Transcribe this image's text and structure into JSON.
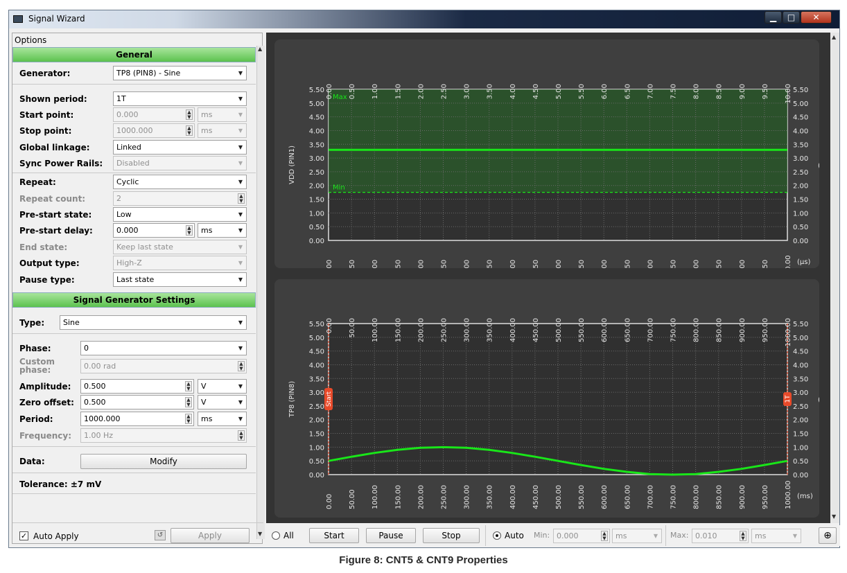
{
  "window": {
    "title": "Signal Wizard"
  },
  "options_label": "Options",
  "general": {
    "header": "General",
    "generator_label": "Generator:",
    "generator_value": "TP8 (PIN8) - Sine",
    "shown_period_label": "Shown period:",
    "shown_period_value": "1T",
    "start_point_label": "Start point:",
    "start_point_value": "0.000",
    "start_point_unit": "ms",
    "stop_point_label": "Stop point:",
    "stop_point_value": "1000.000",
    "stop_point_unit": "ms",
    "global_linkage_label": "Global linkage:",
    "global_linkage_value": "Linked",
    "sync_power_rails_label": "Sync Power Rails:",
    "sync_power_rails_value": "Disabled",
    "repeat_label": "Repeat:",
    "repeat_value": "Cyclic",
    "repeat_count_label": "Repeat count:",
    "repeat_count_value": "2",
    "pre_start_state_label": "Pre-start state:",
    "pre_start_state_value": "Low",
    "pre_start_delay_label": "Pre-start delay:",
    "pre_start_delay_value": "0.000",
    "pre_start_delay_unit": "ms",
    "end_state_label": "End state:",
    "end_state_value": "Keep last state",
    "output_type_label": "Output type:",
    "output_type_value": "High-Z",
    "pause_type_label": "Pause type:",
    "pause_type_value": "Last state"
  },
  "siggen": {
    "header": "Signal Generator Settings",
    "type_label": "Type:",
    "type_value": "Sine",
    "phase_label": "Phase:",
    "phase_value": "0",
    "custom_phase_label": "Custom phase:",
    "custom_phase_value": "0.00 rad",
    "amplitude_label": "Amplitude:",
    "amplitude_value": "0.500",
    "amplitude_unit": "V",
    "zero_offset_label": "Zero offset:",
    "zero_offset_value": "0.500",
    "zero_offset_unit": "V",
    "period_label": "Period:",
    "period_value": "1000.000",
    "period_unit": "ms",
    "frequency_label": "Frequency:",
    "frequency_value": "1.00 Hz",
    "data_label": "Data:",
    "modify_label": "Modify",
    "tolerance": "Tolerance: ±7 mV"
  },
  "footer_left": {
    "auto_apply": "Auto Apply",
    "apply": "Apply"
  },
  "bottombar": {
    "all": "All",
    "start": "Start",
    "pause": "Pause",
    "stop": "Stop",
    "auto": "Auto",
    "min_label": "Min:",
    "min_value": "0.000",
    "min_unit": "ms",
    "max_label": "Max:",
    "max_value": "0.010",
    "max_unit": "ms"
  },
  "caption": "Figure 8: CNT5 & CNT9 Properties",
  "colors": {
    "signal": "#19e619",
    "band": "#2a5a2a",
    "marker": "#e84a2a",
    "grid": "#6a6a6a"
  },
  "chart_data": [
    {
      "type": "line",
      "ylabel": "VDD (PIN1)",
      "yunit": "(V)",
      "xunit": "(µs)",
      "x_ticks": [
        "0.00",
        "0.50",
        "1.00",
        "1.50",
        "2.00",
        "2.50",
        "3.00",
        "3.50",
        "4.00",
        "4.50",
        "5.00",
        "5.50",
        "6.00",
        "6.50",
        "7.00",
        "7.50",
        "8.00",
        "8.50",
        "9.00",
        "9.50",
        "10.00"
      ],
      "y_ticks": [
        "0.00",
        "0.50",
        "1.00",
        "1.50",
        "2.00",
        "2.50",
        "3.00",
        "3.50",
        "4.00",
        "4.50",
        "5.00",
        "5.50"
      ],
      "xlim": [
        0,
        10
      ],
      "ylim": [
        0,
        5.5
      ],
      "band_max_label": "Max",
      "band_min_label": "Min",
      "band": [
        1.75,
        5.5
      ],
      "series": [
        {
          "x": [
            0,
            10
          ],
          "values": [
            3.3,
            3.3
          ]
        }
      ]
    },
    {
      "type": "line",
      "ylabel": "TP8 (PIN8)",
      "yunit": "(V)",
      "xunit": "(ms)",
      "x_ticks": [
        "0.00",
        "50.00",
        "100.00",
        "150.00",
        "200.00",
        "250.00",
        "300.00",
        "350.00",
        "400.00",
        "450.00",
        "500.00",
        "550.00",
        "600.00",
        "650.00",
        "700.00",
        "750.00",
        "800.00",
        "850.00",
        "900.00",
        "950.00",
        "1000.00"
      ],
      "y_ticks": [
        "0.00",
        "0.50",
        "1.00",
        "1.50",
        "2.00",
        "2.50",
        "3.00",
        "3.50",
        "4.00",
        "4.50",
        "5.00",
        "5.50"
      ],
      "xlim": [
        0,
        1000
      ],
      "ylim": [
        0,
        5.5
      ],
      "start_marker": "Start",
      "end_marker": "1T",
      "series": [
        {
          "x": [
            0,
            50,
            100,
            150,
            200,
            250,
            300,
            350,
            400,
            450,
            500,
            550,
            600,
            650,
            700,
            750,
            800,
            850,
            900,
            950,
            1000
          ],
          "values": [
            0.5,
            0.65,
            0.79,
            0.9,
            0.98,
            1.0,
            0.98,
            0.9,
            0.79,
            0.65,
            0.5,
            0.35,
            0.21,
            0.1,
            0.02,
            0.0,
            0.02,
            0.1,
            0.21,
            0.35,
            0.5
          ]
        }
      ]
    }
  ]
}
